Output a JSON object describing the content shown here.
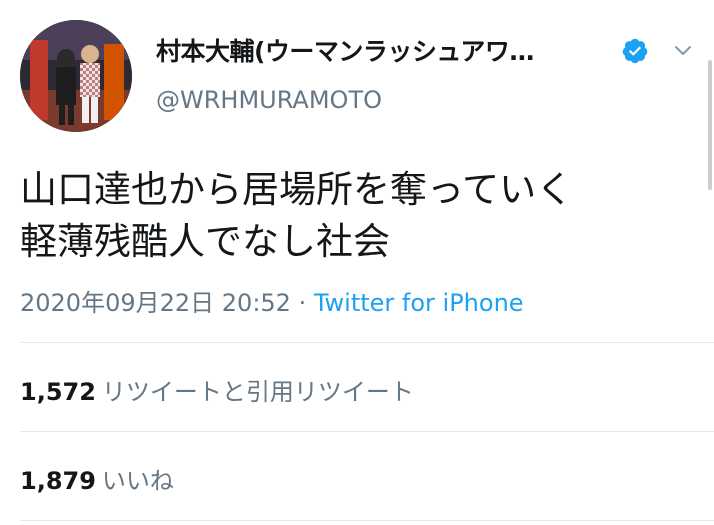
{
  "tweet": {
    "display_name": "村本大輔(ウーマンラッシュアワ…",
    "handle": "@WRHMURAMOTO",
    "verified_icon": "verified-badge-icon",
    "menu_icon": "chevron-down-icon",
    "text_lines": [
      "山口達也から居場所を奪っていく",
      "軽薄残酷人でなし社会"
    ],
    "timestamp": "2020年09月22日 20:52",
    "separator": " · ",
    "source": "Twitter for iPhone",
    "retweets": {
      "count": "1,572",
      "label": "リツイートと引用リツイート"
    },
    "likes": {
      "count": "1,879",
      "label": "いいね"
    }
  },
  "colors": {
    "text_primary": "#14171a",
    "text_secondary": "#657786",
    "accent": "#1da1f2",
    "divider": "#e1e8ed"
  }
}
